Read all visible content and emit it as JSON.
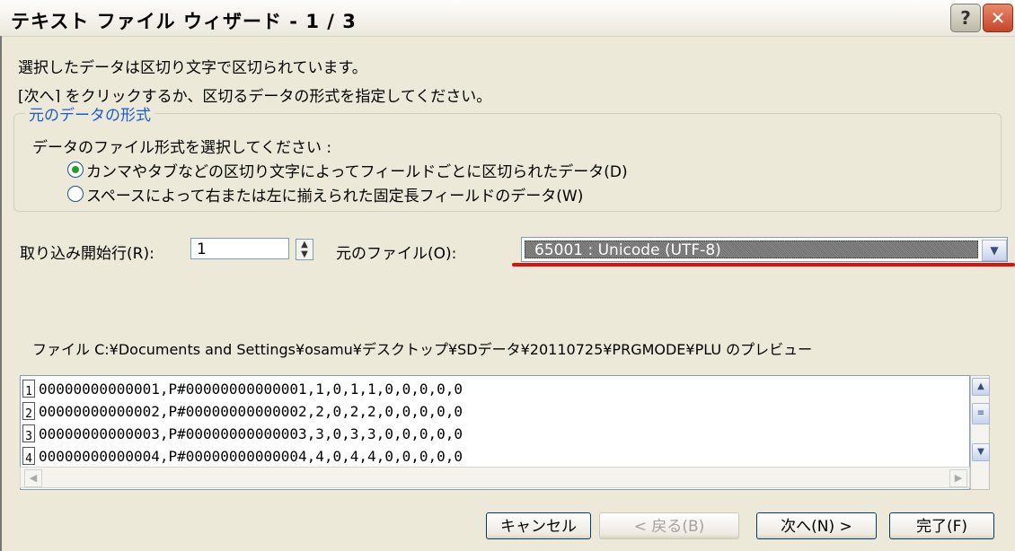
{
  "window": {
    "title": "テキスト ファイル ウィザード - 1 / 3",
    "help_icon": "?",
    "close_icon": "✕"
  },
  "intro": {
    "line1": "選択したデータは区切り文字で区切られています。",
    "line2": "[次へ] をクリックするか、区切るデータの形式を指定してください。"
  },
  "format_group": {
    "legend": "元のデータの形式",
    "prompt": "データのファイル形式を選択してください :",
    "options": [
      {
        "label": "カンマやタブなどの区切り文字によってフィールドごとに区切られたデータ(D)",
        "selected": true
      },
      {
        "label": "スペースによって右または左に揃えられた固定長フィールドのデータ(W)",
        "selected": false
      }
    ]
  },
  "start_row": {
    "label": "取り込み開始行(R):",
    "value": "1"
  },
  "origin": {
    "label": "元のファイル(O):",
    "selected": "65001 : Unicode (UTF-8)"
  },
  "preview": {
    "label": "ファイル C:¥Documents and Settings¥osamu¥デスクトップ¥SDデータ¥20110725¥PRGMODE¥PLU のプレビュー",
    "rows": [
      {
        "num": "1",
        "text": "00000000000001,P#00000000000001,1,0,1,1,0,0,0,0,0"
      },
      {
        "num": "2",
        "text": "00000000000002,P#00000000000002,2,0,2,2,0,0,0,0,0"
      },
      {
        "num": "3",
        "text": "00000000000003,P#00000000000003,3,0,3,3,0,0,0,0,0"
      },
      {
        "num": "4",
        "text": "00000000000004,P#00000000000004,4,0,4,4,0,0,0,0,0"
      }
    ]
  },
  "buttons": {
    "cancel": "キャンセル",
    "back": "< 戻る(B)",
    "next": "次へ(N) >",
    "finish": "完了(F)"
  },
  "colors": {
    "legend": "#1c5bcf",
    "underline": "#e01010",
    "radio_dot": "#21a121"
  }
}
